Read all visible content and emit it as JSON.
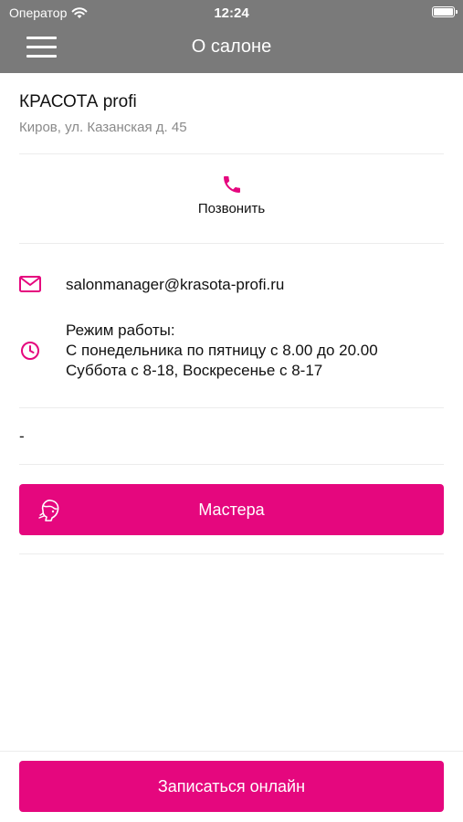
{
  "status_bar": {
    "carrier": "Оператор",
    "time": "12:24"
  },
  "header": {
    "title": "О салоне"
  },
  "salon": {
    "name": "КРАСОТА profi",
    "address": "Киров, ул. Казанская д. 45"
  },
  "call": {
    "label": "Позвонить"
  },
  "email": {
    "value": "salonmanager@krasota-profi.ru"
  },
  "schedule": {
    "title": "Режим работы:",
    "line1": "С понедельника по пятницу с 8.00 до 20.00",
    "line2": "Суббота с 8-18, Воскресенье с 8-17"
  },
  "extra": {
    "text": "-"
  },
  "masters_button": {
    "label": "Мастера"
  },
  "book_button": {
    "label": "Записаться онлайн"
  },
  "colors": {
    "accent": "#e5077e",
    "header_bg": "#7a7a7a",
    "secondary_text": "#8a8a8a"
  },
  "icons": {
    "call": "phone-icon",
    "email": "envelope-icon",
    "schedule": "clock-icon",
    "masters": "master-face-icon",
    "menu": "hamburger-menu-icon"
  }
}
